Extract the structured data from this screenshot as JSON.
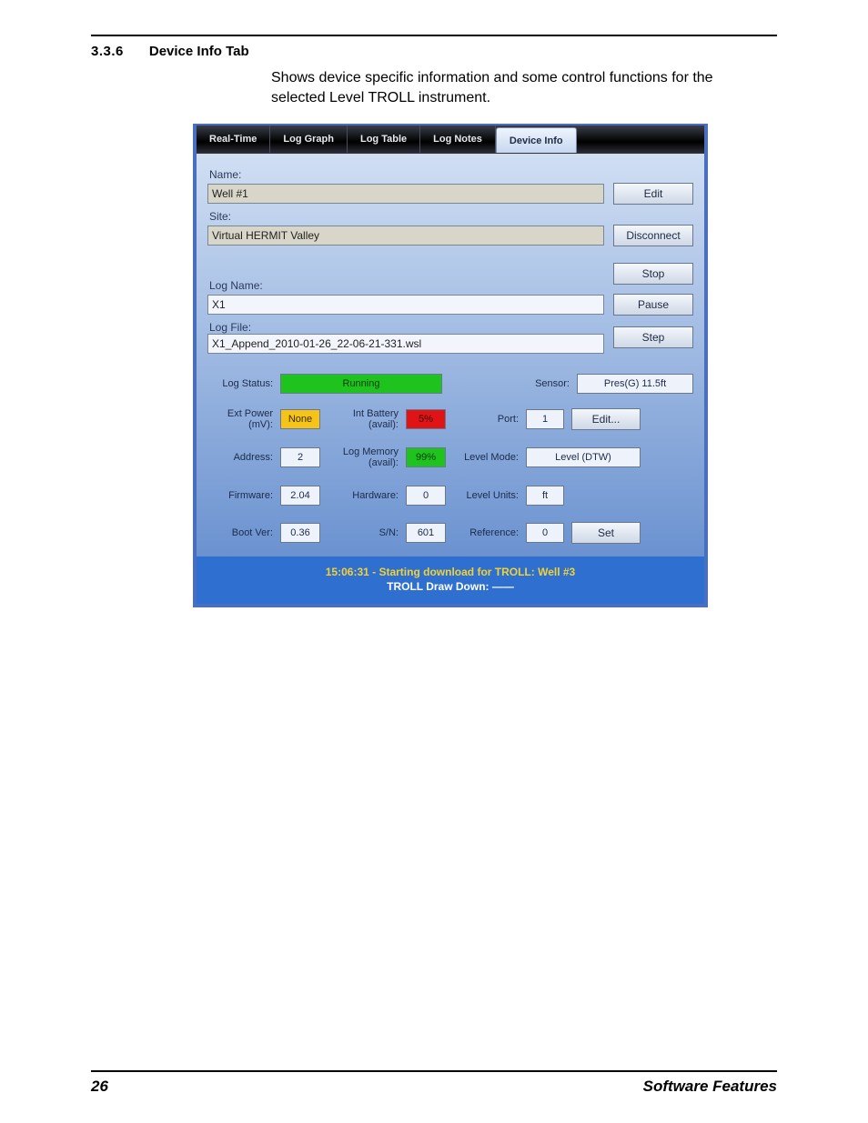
{
  "doc": {
    "section_number": "3.3.6",
    "section_title": "Device Info Tab",
    "section_body": "Shows device specific information and some control functions for the selected Level TROLL instrument.",
    "page_number": "26",
    "footer_title": "Software Features"
  },
  "tabs": {
    "real_time": "Real-Time",
    "log_graph": "Log Graph",
    "log_table": "Log Table",
    "log_notes": "Log Notes",
    "device_info": "Device Info"
  },
  "fields": {
    "name_label": "Name:",
    "name_value": "Well #1",
    "site_label": "Site:",
    "site_value": "Virtual HERMIT Valley",
    "log_name_label": "Log Name:",
    "log_name_value": "X1",
    "log_file_label": "Log File:",
    "log_file_value": "X1_Append_2010-01-26_22-06-21-331.wsl"
  },
  "buttons": {
    "edit": "Edit",
    "disconnect": "Disconnect",
    "stop": "Stop",
    "pause": "Pause",
    "step": "Step",
    "edit_port": "Edit...",
    "set": "Set"
  },
  "status": {
    "log_status_label": "Log Status:",
    "log_status_value": "Running",
    "sensor_label": "Sensor:",
    "sensor_value": "Pres(G) 11.5ft",
    "ext_power_label": "Ext Power (mV):",
    "ext_power_value": "None",
    "int_batt_label": "Int Battery (avail):",
    "int_batt_value": "5%",
    "port_label": "Port:",
    "port_value": "1",
    "address_label": "Address:",
    "address_value": "2",
    "log_mem_label": "Log Memory (avail):",
    "log_mem_value": "99%",
    "level_mode_label": "Level Mode:",
    "level_mode_value": "Level (DTW)",
    "firmware_label": "Firmware:",
    "firmware_value": "2.04",
    "hardware_label": "Hardware:",
    "hardware_value": "0",
    "level_units_label": "Level Units:",
    "level_units_value": "ft",
    "bootver_label": "Boot Ver:",
    "bootver_value": "0.36",
    "sn_label": "S/N:",
    "sn_value": "601",
    "reference_label": "Reference:",
    "reference_value": "0"
  },
  "footer": {
    "line1": "15:06:31 - Starting download for TROLL: Well #3",
    "line2": "TROLL Draw Down: ——"
  }
}
